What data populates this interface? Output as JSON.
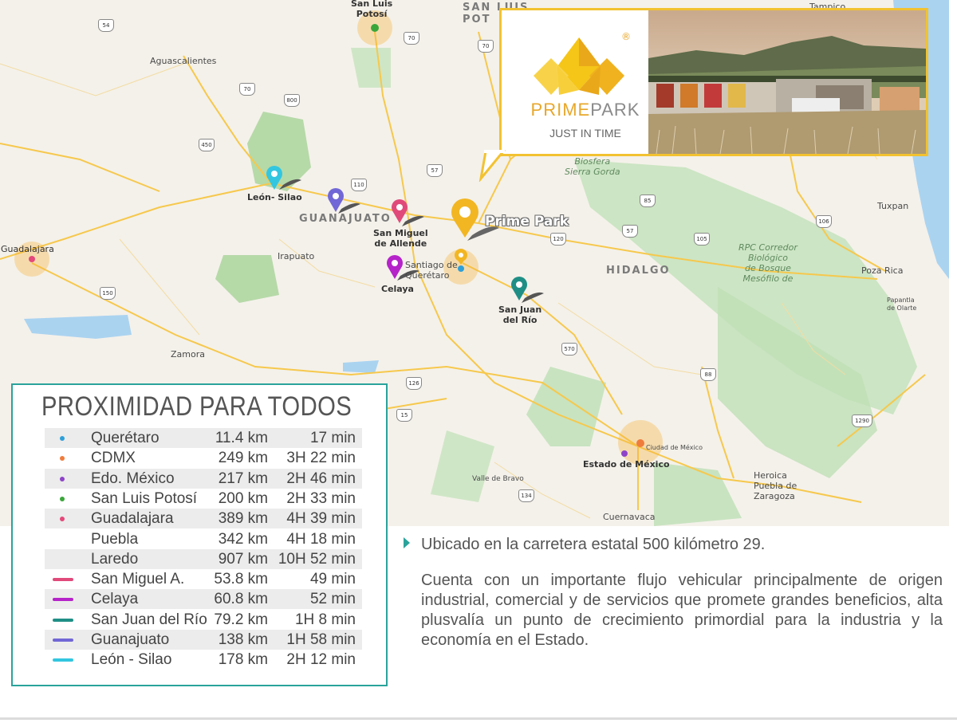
{
  "map": {
    "places": {
      "san_luis_potosi": "San Luis\nPotosí",
      "san_luis_cut": "SAN LUIS\nPOT",
      "tampico": "Tampico",
      "aguascalientes": "Aguascalientes",
      "guanajuato_state": "GUANAJUATO",
      "hidalgo_state": "HIDALGO",
      "guadalajara": "Guadalajara",
      "irapuato": "Irapuato",
      "zamora": "Zamora",
      "queretaro": "Santiago de\nQuerétaro",
      "biosfera": "Biosfera\nSierra Gorda",
      "tuxpan": "Tuxpan",
      "poza_rica": "Poza Rica",
      "papantla": "Papantla\nde Olarte",
      "rpc": "RPC Corredor\nBiológico\nde Bosque\nMesófilo de",
      "ciudad_mexico": "Ciudad de México",
      "valle_bravo": "Valle de Bravo",
      "heroica_puebla": "Heroica\nPuebla de\nZaragoza",
      "cuernavaca": "Cuernavaca"
    },
    "markers": {
      "leon_silao": "León- Silao",
      "san_miguel": "San Miguel\nde Allende",
      "celaya": "Celaya",
      "san_juan": "San Juan\ndel Río",
      "prime_park": "Prime Park",
      "estado_mexico": "Estado de México"
    },
    "highways": [
      "54",
      "70",
      "57",
      "800",
      "450",
      "110",
      "85",
      "57",
      "120",
      "105",
      "106",
      "70",
      "150",
      "570",
      "126",
      "15",
      "88",
      "134",
      "1290",
      "70"
    ]
  },
  "callout": {
    "logo_word_a": "PRIME",
    "logo_word_b": "PARK",
    "registered": "®",
    "tagline": "JUST IN TIME"
  },
  "panel": {
    "title": "PROXIMIDAD PARA TODOS",
    "rows": [
      {
        "name": "Querétaro",
        "km": "11.4 km",
        "time": "17 min",
        "marker": "dot",
        "color": "#2e9fd8"
      },
      {
        "name": "CDMX",
        "km": "249 km",
        "time": "3H 22 min",
        "marker": "dot",
        "color": "#f07c3c"
      },
      {
        "name": "Edo. México",
        "km": "217 km",
        "time": "2H 46 min",
        "marker": "dot",
        "color": "#8e44c8"
      },
      {
        "name": "San Luis Potosí",
        "km": "200 km",
        "time": "2H 33 min",
        "marker": "dot",
        "color": "#3aa63a"
      },
      {
        "name": "Guadalajara",
        "km": "389 km",
        "time": "4H 39 min",
        "marker": "dot",
        "color": "#e5487a"
      },
      {
        "name": "Puebla",
        "km": "342 km",
        "time": "4H 18 min",
        "marker": "none",
        "color": ""
      },
      {
        "name": "Laredo",
        "km": "907 km",
        "time": "10H 52 min",
        "marker": "none",
        "color": ""
      },
      {
        "name": "San Miguel A.",
        "km": "53.8 km",
        "time": "49 min",
        "marker": "line",
        "color": "#e04a7a"
      },
      {
        "name": "Celaya",
        "km": "60.8 km",
        "time": "52 min",
        "marker": "line",
        "color": "#b523c9"
      },
      {
        "name": "San Juan del Río",
        "km": "79.2 km",
        "time": "1H 8 min",
        "marker": "line",
        "color": "#1f8f86"
      },
      {
        "name": "Guanajuato",
        "km": "138 km",
        "time": "1H 58 min",
        "marker": "line",
        "color": "#7267d6"
      },
      {
        "name": "León - Silao",
        "km": "178 km",
        "time": "2H 12 min",
        "marker": "line",
        "color": "#33c6e0"
      }
    ]
  },
  "description": {
    "line1": "Ubicado en la carretera estatal 500 kilómetro 29.",
    "paragraph": "Cuenta con un importante flujo vehicular principalmente de origen industrial, comercial y de servicios que promete grandes beneficios, alta plusvalía un punto de crecimiento primordial para la industria y la economía en el Estado."
  },
  "colors": {
    "accent_teal": "#2aa39b",
    "accent_gold": "#f2c230"
  }
}
